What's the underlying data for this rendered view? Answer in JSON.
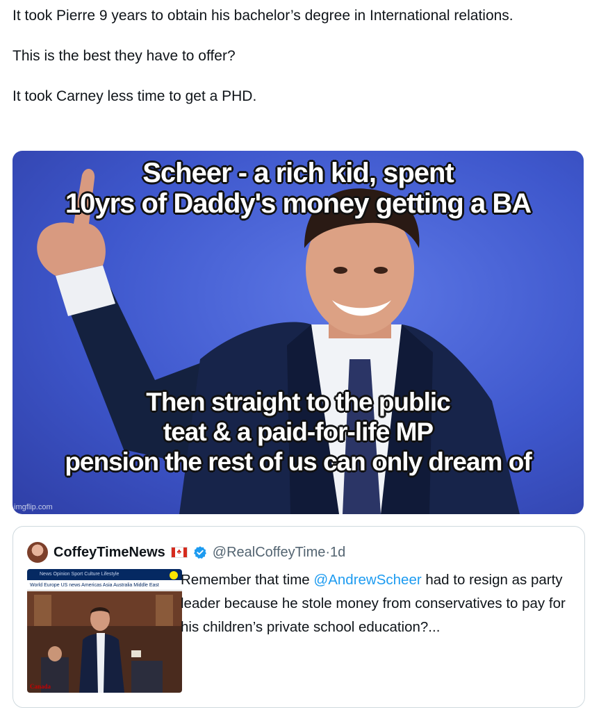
{
  "post": {
    "paragraphs": [
      "It took Pierre 9 years to obtain his bachelor’s degree in International relations.",
      "This is the best they have to offer?",
      "It took Carney less time to get a PHD."
    ]
  },
  "meme": {
    "caption_top": [
      "Scheer - a rich kid, spent",
      "10yrs of Daddy's money getting a BA"
    ],
    "caption_bottom": [
      "Then straight to the public",
      "teat & a paid-for-life MP",
      "pension the rest of us can only dream of"
    ],
    "watermark": "imgflip.com"
  },
  "quote": {
    "display_name": "CoffeyTimeNews",
    "flag_icon": "canada-flag-icon",
    "verified_icon": "verified-badge-icon",
    "handle": "@RealCoffeyTime",
    "separator": " · ",
    "time": "1d",
    "text_before": "Remember that time ",
    "mention": "@AndrewScheer",
    "text_after": " had to resign as party leader because he stole money from conservatives to pay for his children’s private school education?...",
    "link_card": {
      "nav_top": "News   Opinion   Sport   Culture   Lifestyle",
      "nav_sub": "World   Europe   US news   Americas   Asia   Australia   Middle East",
      "section": "Canada"
    }
  },
  "colors": {
    "link": "#1d9bf0",
    "border": "#cfd9de",
    "meme_bg": "#3e57cc"
  }
}
